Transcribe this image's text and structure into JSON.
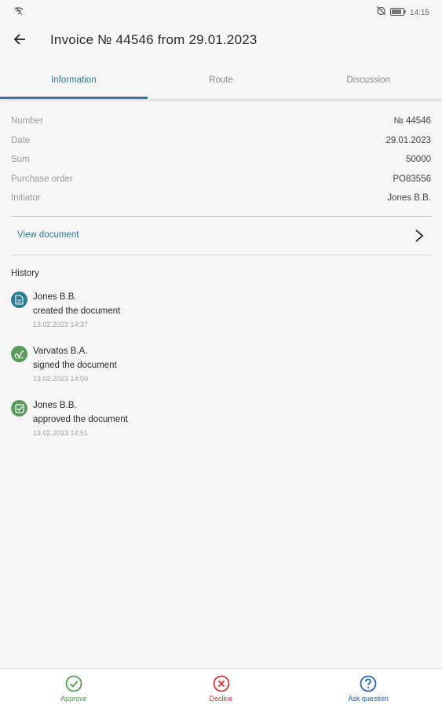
{
  "status_bar": {
    "time": "14:15",
    "wifi_icon": "wifi-off-icon",
    "alarm_icon": "alarm-off-icon",
    "battery_icon": "battery-icon"
  },
  "header": {
    "back_icon": "arrow-left-icon",
    "title": "Invoice № 44546 from 29.01.2023"
  },
  "tabs": [
    {
      "label": "Information",
      "active": true
    },
    {
      "label": "Route",
      "active": false
    },
    {
      "label": "Discussion",
      "active": false
    }
  ],
  "details": [
    {
      "label": "Number",
      "value": "№ 44546"
    },
    {
      "label": "Date",
      "value": "29.01.2023"
    },
    {
      "label": "Sum",
      "value": "50000"
    },
    {
      "label": "Purchase order",
      "value": "PO83556"
    },
    {
      "label": "Initiator",
      "value": "Jones B.B."
    }
  ],
  "view_document": {
    "label": "View document",
    "icon": "chevron-right-icon"
  },
  "history": {
    "title": "History",
    "items": [
      {
        "user": "Jones B.B.",
        "action": "created the document",
        "time": "13.02.2023 14:37",
        "icon": "document-icon",
        "color": "#2b7a96"
      },
      {
        "user": "Varvatos B.A.",
        "action": "signed the document",
        "time": "13.02.2023 14:50",
        "icon": "signature-icon",
        "color": "#5a9a5a"
      },
      {
        "user": "Jones B.B.",
        "action": "approved the document",
        "time": "13.02.2023 14:51",
        "icon": "checkbox-icon",
        "color": "#5a9a5a"
      }
    ]
  },
  "actions": [
    {
      "label": "Approve",
      "icon": "check-circle-icon",
      "color": "#4a9a4a"
    },
    {
      "label": "Decline",
      "icon": "x-circle-icon",
      "color": "#d03030"
    },
    {
      "label": "Ask question",
      "icon": "question-circle-icon",
      "color": "#2060b0"
    }
  ],
  "colors": {
    "accent": "#2b7a96",
    "background": "#f6f6f6"
  }
}
